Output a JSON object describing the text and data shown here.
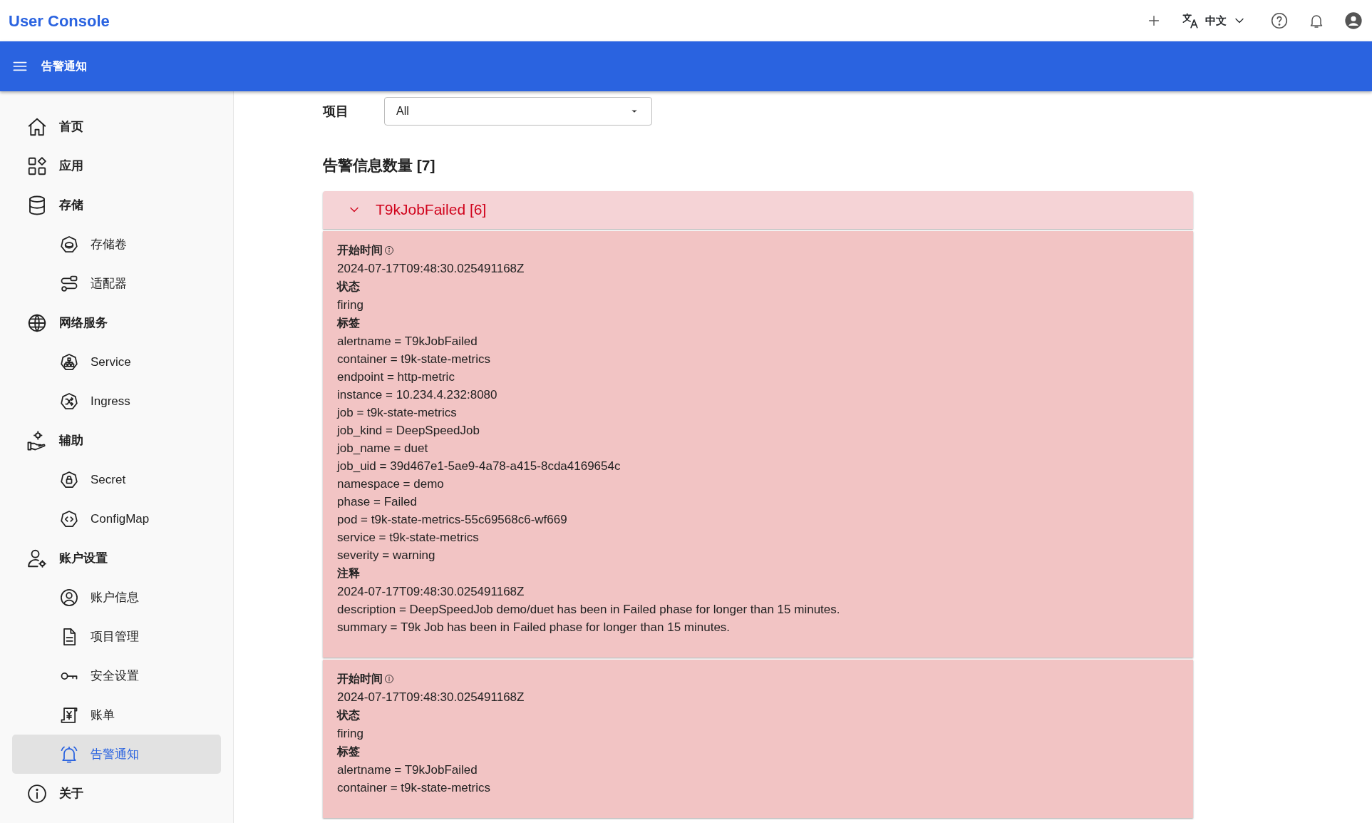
{
  "topbar": {
    "title": "User Console",
    "language": "中文"
  },
  "appbar": {
    "title": "告警通知"
  },
  "sidebar": {
    "items": [
      {
        "label": "首页",
        "selected": false
      },
      {
        "label": "应用",
        "selected": false
      },
      {
        "label": "存储",
        "selected": false,
        "children": [
          {
            "label": "存储卷",
            "selected": false
          },
          {
            "label": "适配器",
            "selected": false
          }
        ]
      },
      {
        "label": "网络服务",
        "selected": false,
        "children": [
          {
            "label": "Service",
            "selected": false
          },
          {
            "label": "Ingress",
            "selected": false
          }
        ]
      },
      {
        "label": "辅助",
        "selected": false,
        "children": [
          {
            "label": "Secret",
            "selected": false
          },
          {
            "label": "ConfigMap",
            "selected": false
          }
        ]
      },
      {
        "label": "账户设置",
        "selected": false,
        "children": [
          {
            "label": "账户信息",
            "selected": false
          },
          {
            "label": "项目管理",
            "selected": false
          },
          {
            "label": "安全设置",
            "selected": false
          },
          {
            "label": "账单",
            "selected": false
          },
          {
            "label": "告警通知",
            "selected": true
          }
        ]
      },
      {
        "label": "关于",
        "selected": false
      }
    ]
  },
  "filter": {
    "label": "项目",
    "value": "All"
  },
  "count_title": "告警信息数量 [7]",
  "groups": [
    {
      "title": "T9kJobFailed [6]",
      "expanded": true,
      "alerts": [
        {
          "sections": [
            {
              "title": "开始时间",
              "info": true,
              "lines": [
                "2024-07-17T09:48:30.025491168Z"
              ]
            },
            {
              "title": "状态",
              "info": false,
              "lines": [
                "firing"
              ]
            },
            {
              "title": "标签",
              "info": false,
              "lines": [
                "alertname = T9kJobFailed",
                "container = t9k-state-metrics",
                "endpoint = http-metric",
                "instance = 10.234.4.232:8080",
                "job = t9k-state-metrics",
                "job_kind = DeepSpeedJob",
                "job_name = duet",
                "job_uid = 39d467e1-5ae9-4a78-a415-8cda4169654c",
                "namespace = demo",
                "phase = Failed",
                "pod = t9k-state-metrics-55c69568c6-wf669",
                "service = t9k-state-metrics",
                "severity = warning"
              ]
            },
            {
              "title": "注释",
              "info": false,
              "lines": [
                "2024-07-17T09:48:30.025491168Z",
                "description = DeepSpeedJob demo/duet has been in Failed phase for longer than 15 minutes.",
                "summary = T9k Job has been in Failed phase for longer than 15 minutes."
              ]
            }
          ]
        },
        {
          "sections": [
            {
              "title": "开始时间",
              "info": true,
              "lines": [
                "2024-07-17T09:48:30.025491168Z"
              ]
            },
            {
              "title": "状态",
              "info": false,
              "lines": [
                "firing"
              ]
            },
            {
              "title": "标签",
              "info": false,
              "lines": [
                "alertname = T9kJobFailed",
                "container = t9k-state-metrics"
              ]
            }
          ]
        }
      ]
    }
  ]
}
